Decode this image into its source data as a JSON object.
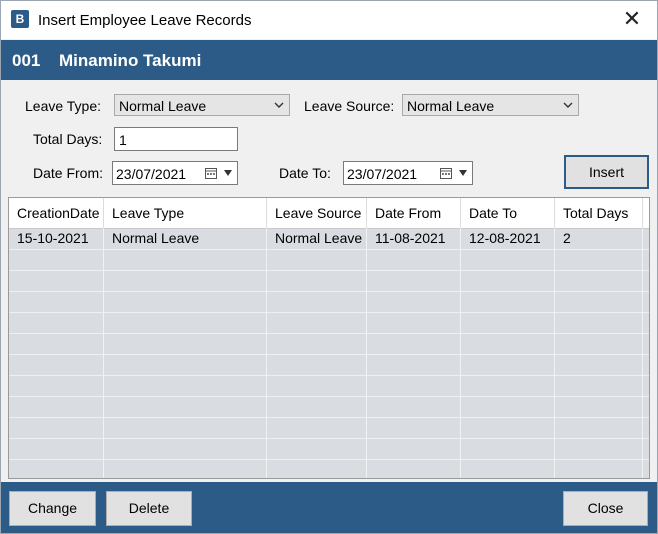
{
  "window": {
    "title": "Insert Employee Leave Records"
  },
  "banner": {
    "employee_id": "001",
    "employee_name": "Minamino Takumi"
  },
  "form": {
    "leave_type_label": "Leave Type:",
    "leave_type_value": "Normal Leave",
    "leave_source_label": "Leave Source:",
    "leave_source_value": "Normal Leave",
    "total_days_label": "Total Days:",
    "total_days_value": "1",
    "date_from_label": "Date From:",
    "date_from_value": "23/07/2021",
    "date_to_label": "Date To:",
    "date_to_value": "23/07/2021",
    "insert_label": "Insert"
  },
  "grid": {
    "columns": [
      "CreationDate",
      "Leave Type",
      "Leave Source",
      "Date From",
      "Date To",
      "Total Days"
    ],
    "rows": [
      [
        "15-10-2021",
        "Normal Leave",
        "Normal Leave",
        "11-08-2021",
        "12-08-2021",
        "2"
      ]
    ]
  },
  "footer": {
    "change_label": "Change",
    "delete_label": "Delete",
    "close_label": "Close"
  },
  "colors": {
    "accent": "#2b5b86",
    "grid_bg": "#d9dde1"
  }
}
